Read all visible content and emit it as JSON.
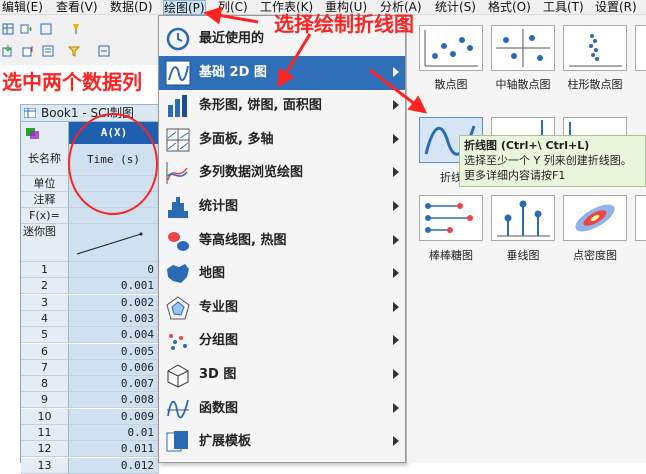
{
  "menubar": {
    "items": [
      "编辑(E)",
      "查看(V)",
      "数据(D)",
      "绘图(P)",
      "列(C)",
      "工作表(K)",
      "重构(U)",
      "分析(A)",
      "统计(S)",
      "格式(O)",
      "工具(T)",
      "设置(R)"
    ]
  },
  "book": {
    "title": "Book1 - SCI制图",
    "col_header": "A(X)",
    "row_labels": [
      "长名称",
      "单位",
      "注释",
      "F(x)=",
      "迷你图"
    ],
    "long_name": "Time (s)",
    "rows": [
      {
        "n": "1",
        "v": "0"
      },
      {
        "n": "2",
        "v": "0.001"
      },
      {
        "n": "3",
        "v": "0.002"
      },
      {
        "n": "4",
        "v": "0.003"
      },
      {
        "n": "5",
        "v": "0.004"
      },
      {
        "n": "6",
        "v": "0.005"
      },
      {
        "n": "7",
        "v": "0.006"
      },
      {
        "n": "8",
        "v": "0.007"
      },
      {
        "n": "9",
        "v": "0.008"
      },
      {
        "n": "10",
        "v": "0.009"
      },
      {
        "n": "11",
        "v": "0.01"
      },
      {
        "n": "12",
        "v": "0.011"
      },
      {
        "n": "13",
        "v": "0.012"
      }
    ]
  },
  "dropdown": {
    "items": [
      {
        "label": "最近使用的",
        "icon": "recent-icon"
      },
      {
        "label": "基础 2D 图",
        "icon": "basic-2d-icon",
        "highlighted": true
      },
      {
        "label": "条形图, 饼图, 面积图",
        "icon": "bar-chart-icon"
      },
      {
        "label": "多面板, 多轴",
        "icon": "multi-panel-icon"
      },
      {
        "label": "多列数据浏览绘图",
        "icon": "multi-column-icon"
      },
      {
        "label": "统计图",
        "icon": "histogram-icon"
      },
      {
        "label": "等高线图, 热图",
        "icon": "contour-icon"
      },
      {
        "label": "地图",
        "icon": "map-icon"
      },
      {
        "label": "专业图",
        "icon": "radar-icon"
      },
      {
        "label": "分组图",
        "icon": "group-icon"
      },
      {
        "label": "3D 图",
        "icon": "3d-icon"
      },
      {
        "label": "函数图",
        "icon": "function-icon"
      },
      {
        "label": "扩展模板",
        "icon": "template-icon"
      }
    ]
  },
  "gallery": {
    "items": [
      {
        "label": "散点图",
        "icon": "scatter-icon"
      },
      {
        "label": "中轴散点图",
        "icon": "center-axis-scatter-icon"
      },
      {
        "label": "柱形散点图",
        "icon": "column-scatter-icon"
      },
      {
        "label": "折线图",
        "icon": "line-icon",
        "selected": true
      },
      {
        "label": "棒棒糖图",
        "icon": "lollipop-icon"
      },
      {
        "label": "垂线图",
        "icon": "drop-line-icon"
      },
      {
        "label": "点密度图",
        "icon": "density-dot-icon"
      }
    ],
    "line_label_partial": "折线"
  },
  "tooltip": {
    "title": "折线图 (Ctrl+\\ Ctrl+L)",
    "line1": "选择至少一个 Y 列来创建折线图。",
    "line2": "更多详细内容请按F1"
  },
  "annotations": {
    "select_columns": "选中两个数据列",
    "select_plot": "选择绘制折线图"
  },
  "colors": {
    "highlight": "#2f6eb8",
    "annotation": "#ff2222",
    "column_header": "#1f5fb0"
  }
}
